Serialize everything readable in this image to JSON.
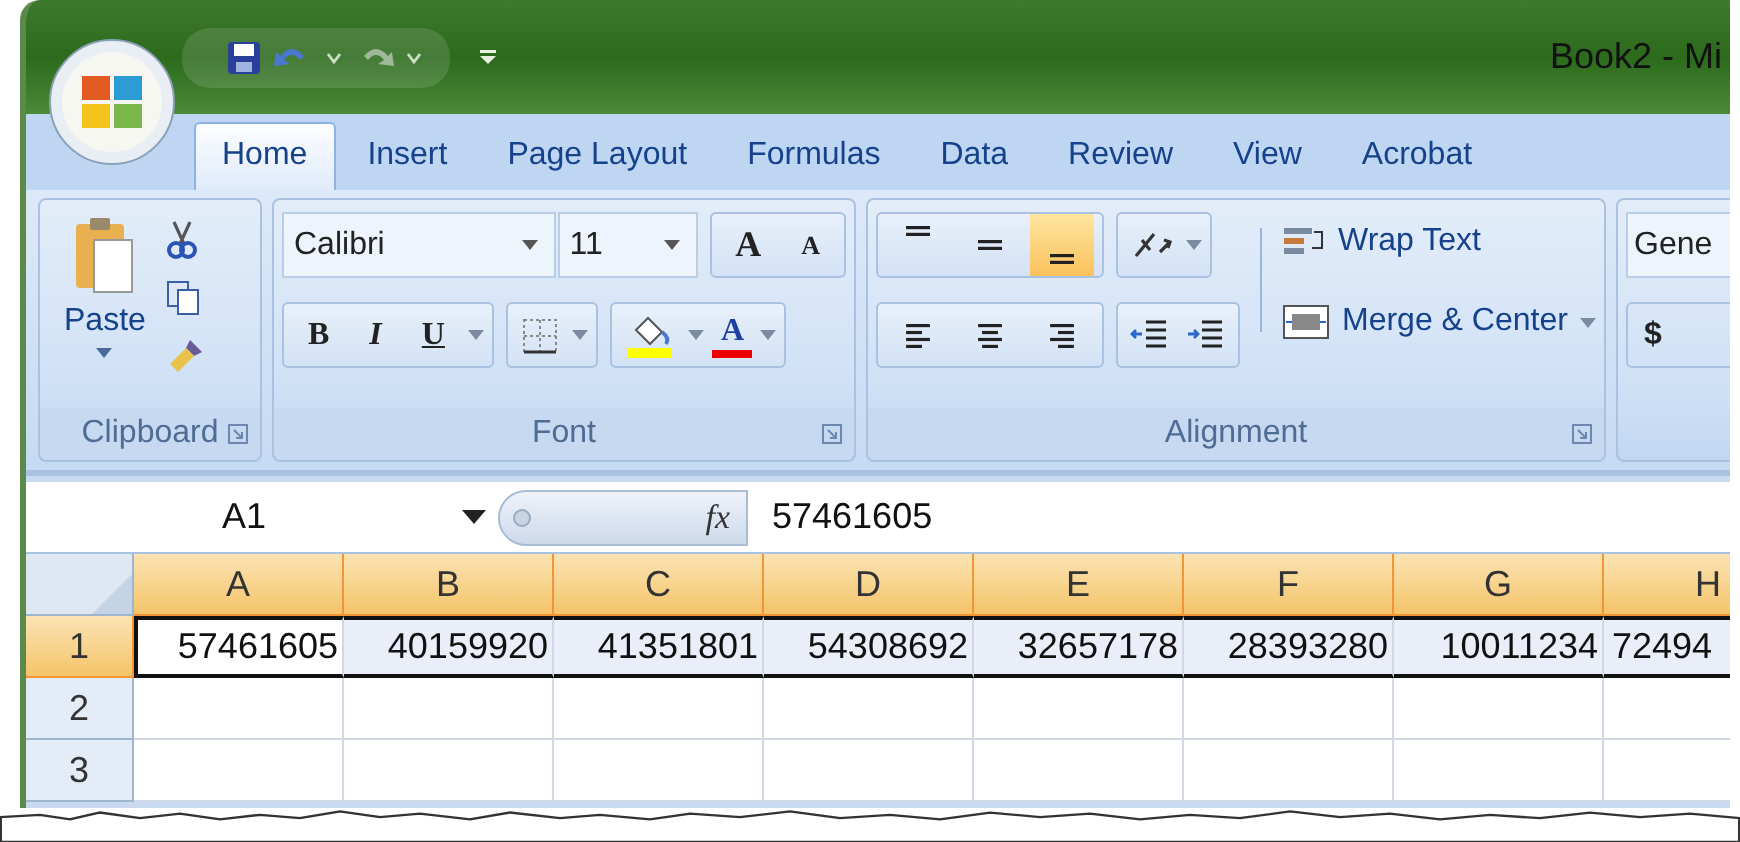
{
  "window": {
    "title": "Book2 - Mi"
  },
  "tabs": [
    {
      "label": "Home",
      "selected": true
    },
    {
      "label": "Insert",
      "selected": false
    },
    {
      "label": "Page Layout",
      "selected": false
    },
    {
      "label": "Formulas",
      "selected": false
    },
    {
      "label": "Data",
      "selected": false
    },
    {
      "label": "Review",
      "selected": false
    },
    {
      "label": "View",
      "selected": false
    },
    {
      "label": "Acrobat",
      "selected": false
    }
  ],
  "ribbon": {
    "clipboard": {
      "label": "Clipboard",
      "paste": "Paste"
    },
    "font": {
      "label": "Font",
      "font_name": "Calibri",
      "font_size": "11",
      "grow": "A",
      "shrink": "A",
      "bold": "B",
      "italic": "I",
      "underline": "U",
      "font_color": "A"
    },
    "alignment": {
      "label": "Alignment",
      "vertical": [
        {
          "kind": "top",
          "selected": false
        },
        {
          "kind": "middle",
          "selected": false
        },
        {
          "kind": "bottom",
          "selected": true
        }
      ],
      "horizontal": [
        {
          "kind": "left",
          "selected": false
        },
        {
          "kind": "center",
          "selected": false
        },
        {
          "kind": "right",
          "selected": false
        }
      ],
      "wrap_text": "Wrap Text",
      "merge": "Merge & Center"
    },
    "number": {
      "format": "Gene",
      "currency": "$"
    }
  },
  "formula_bar": {
    "name_box": "A1",
    "function_label": "fx",
    "formula": "57461605"
  },
  "sheet": {
    "columns": [
      {
        "label": "A",
        "highlighted": true
      },
      {
        "label": "B",
        "highlighted": true
      },
      {
        "label": "C",
        "highlighted": true
      },
      {
        "label": "D",
        "highlighted": true
      },
      {
        "label": "E",
        "highlighted": true
      },
      {
        "label": "F",
        "highlighted": true
      },
      {
        "label": "G",
        "highlighted": true
      },
      {
        "label": "H",
        "highlighted": true
      }
    ],
    "rows": [
      {
        "label": "1",
        "selected": true,
        "cells": [
          "57461605",
          "40159920",
          "41351801",
          "54308692",
          "32657178",
          "28393280",
          "10011234",
          "72494"
        ]
      },
      {
        "label": "2",
        "selected": false,
        "cells": []
      },
      {
        "label": "3",
        "selected": false,
        "cells": []
      }
    ]
  }
}
